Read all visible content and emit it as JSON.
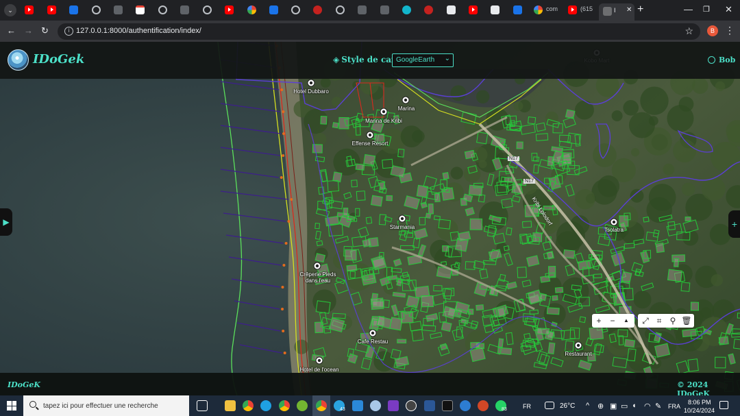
{
  "browser": {
    "tab_menu_icon": "chevron-down-icon",
    "tabs": [
      {
        "favicon": "youtube-icon",
        "label": ""
      },
      {
        "favicon": "youtube-icon",
        "label": ""
      },
      {
        "favicon": "blue-app-icon",
        "label": ""
      },
      {
        "favicon": "globe-icon",
        "label": ""
      },
      {
        "favicon": "lv-icon",
        "label": ""
      },
      {
        "favicon": "gmail-icon",
        "label": ""
      },
      {
        "favicon": "globe-icon",
        "label": ""
      },
      {
        "favicon": "dark-site-icon",
        "label": ""
      },
      {
        "favicon": "globe-icon",
        "label": ""
      },
      {
        "favicon": "youtube-icon",
        "label": ""
      },
      {
        "favicon": "google-icon",
        "label": ""
      },
      {
        "favicon": "blue-app-icon",
        "label": ""
      },
      {
        "favicon": "globe-icon",
        "label": ""
      },
      {
        "favicon": "red-site-icon",
        "label": ""
      },
      {
        "favicon": "github-icon",
        "label": ""
      },
      {
        "favicon": "dark-site-icon",
        "label": ""
      },
      {
        "favicon": "chat-icon",
        "label": ""
      },
      {
        "favicon": "cv-icon",
        "label": ""
      },
      {
        "favicon": "red-site-icon",
        "label": ""
      },
      {
        "favicon": "white-site-icon",
        "label": ""
      },
      {
        "favicon": "youtube-icon",
        "label": ""
      },
      {
        "favicon": "doc-icon",
        "label": ""
      },
      {
        "favicon": "gemini-icon",
        "label": ""
      },
      {
        "favicon": "google-icon",
        "label": "com"
      },
      {
        "favicon": "youtube-icon",
        "label": "(615"
      }
    ],
    "active_tab": {
      "favicon": "idogek-favicon-icon",
      "label": "I"
    },
    "url": "127.0.0.1:8000/authentification/index/",
    "profile_initial": "B"
  },
  "header": {
    "brand": "IDoGek",
    "style_label": "Style de carte:",
    "style_selected": "GoogleEarth",
    "user": "Bob"
  },
  "map": {
    "pois": [
      {
        "label": "Hotel Dubbaro"
      },
      {
        "label": "Marina"
      },
      {
        "label": "Marina de Kribi"
      },
      {
        "label": "Effense Resort"
      },
      {
        "label": "Starmania"
      },
      {
        "label": "Crêperie Pieds\ndans l'eau"
      },
      {
        "label": "Cafe Restau"
      },
      {
        "label": "Hotel de l'ocean"
      },
      {
        "label": "Restaurant"
      },
      {
        "label": "Tsolatra"
      },
      {
        "label": "Kobo Mart"
      }
    ],
    "roads": [
      {
        "label": "N17"
      },
      {
        "label": "N17"
      },
      {
        "label": "Kribi Lolodorf"
      }
    ],
    "controls": {
      "zoom_in": "+",
      "zoom_out": "−",
      "north": "▲"
    },
    "colors": {
      "building_outline": "#26c83a",
      "admin_boundary": "#5b3fd6",
      "coast_line_yellow": "#d6e020",
      "coast_line_red": "#d92a1e",
      "coast_line_green": "#5be05b"
    }
  },
  "footer": {
    "brand": "IDoGeK",
    "copyright": "© 2024 IDoGeK"
  },
  "taskbar": {
    "search_placeholder": "tapez ici pour effectuer une recherche",
    "telegram_badge": "43",
    "whatsapp_badge": "83",
    "language": "FR",
    "weather": "26°C",
    "keyboard": "FRA",
    "time": "8:06 PM",
    "date": "10/24/2024"
  }
}
